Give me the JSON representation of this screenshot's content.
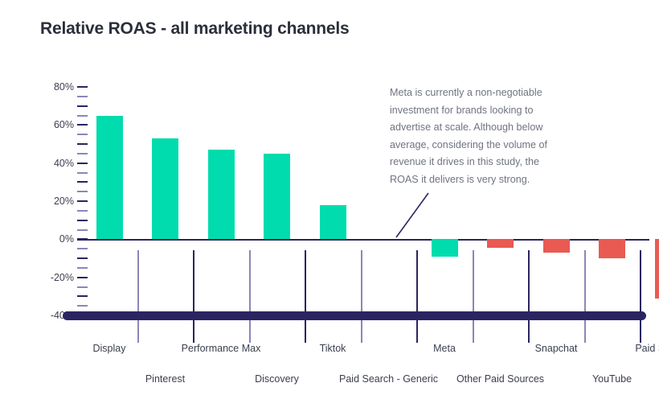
{
  "chart_data": {
    "type": "bar",
    "title": "Relative ROAS - all marketing channels",
    "xlabel": "",
    "ylabel": "",
    "ylim": [
      -40,
      80
    ],
    "grid": false,
    "legend": "none",
    "categories": [
      "Display",
      "Pinterest",
      "Performance Max",
      "Discovery",
      "Tiktok",
      "Paid Search - Generic",
      "Meta",
      "Other Paid Sources",
      "Snapchat",
      "YouTube",
      "Paid Shopping"
    ],
    "values": [
      65,
      53,
      47,
      45,
      18,
      0,
      -9,
      -4.5,
      -7,
      -10,
      -31
    ],
    "bar_colors": [
      "#00dcad",
      "#00dcad",
      "#00dcad",
      "#00dcad",
      "#00dcad",
      "none",
      "#00dcad",
      "#e85a52",
      "#e85a52",
      "#e85a52",
      "#e85a52"
    ],
    "ytick_labels": [
      "80%",
      "60%",
      "40%",
      "20%",
      "0%",
      "-20%",
      "-40%"
    ],
    "ytick_values": [
      80,
      60,
      40,
      20,
      0,
      -20,
      -40
    ],
    "minor_tick_step": 5,
    "annotations": [
      {
        "text": "Meta is currently a non-negotiable investment for brands looking to advertise at scale. Although below average, considering the volume of revenue it drives in this study, the ROAS it delivers is very strong.",
        "points_to": "Meta"
      }
    ],
    "baseline_marker": {
      "value": -40,
      "color": "#2a2560"
    }
  },
  "colors": {
    "positive": "#00dcad",
    "negative": "#e85a52",
    "axis": "#2a2560",
    "tick_light": "#8b86b8",
    "title": "#2b2f3a",
    "annotation": "#6f7480",
    "label": "#3b3f4d"
  }
}
